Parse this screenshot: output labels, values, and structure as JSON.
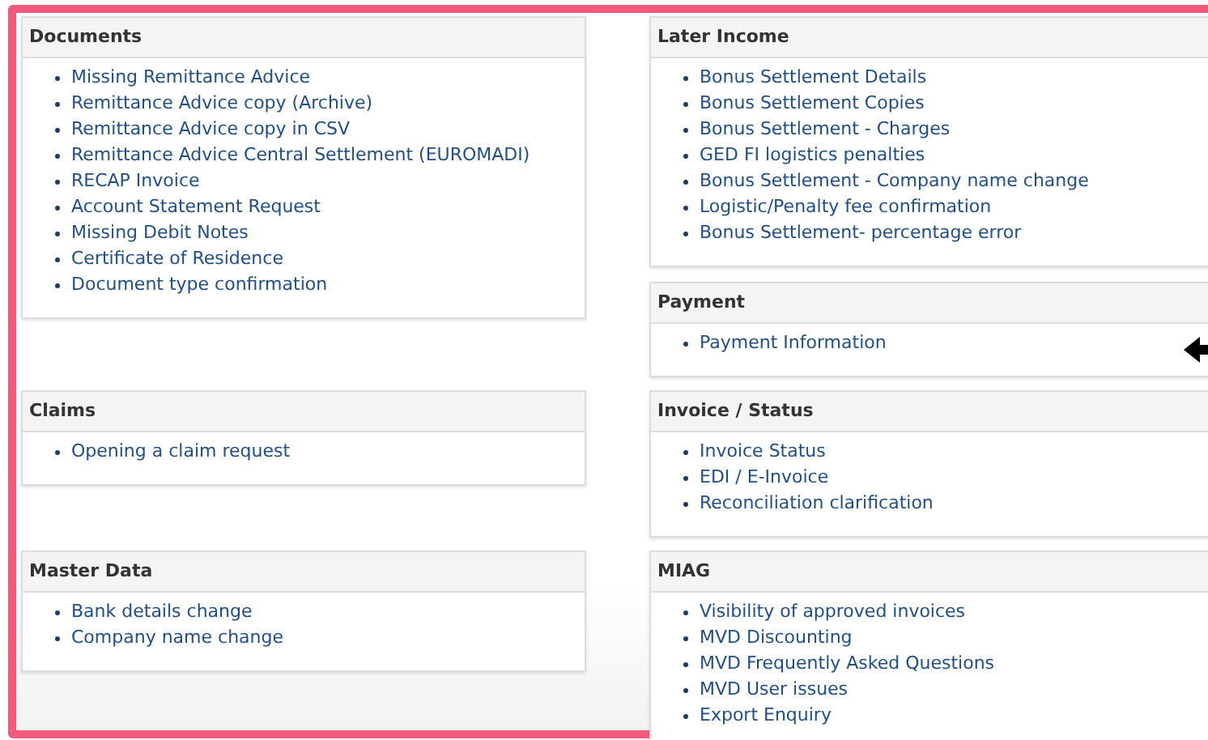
{
  "rows": [
    {
      "left": [
        {
          "title": "Documents",
          "items": [
            "Missing Remittance Advice",
            "Remittance Advice copy (Archive)",
            "Remittance Advice copy in CSV",
            "Remittance Advice Central Settlement (EUROMADI)",
            "RECAP Invoice",
            "Account Statement Request",
            "Missing Debit Notes",
            "Certificate of Residence",
            "Document type confirmation"
          ]
        }
      ],
      "right": [
        {
          "title": "Later Income",
          "items": [
            "Bonus Settlement Details",
            "Bonus Settlement Copies",
            "Bonus Settlement - Charges",
            "GED FI logistics penalties",
            "Bonus Settlement - Company name change",
            "Logistic/Penalty fee confirmation",
            "Bonus Settlement- percentage error"
          ]
        },
        {
          "title": "Payment",
          "items": [
            "Payment Information"
          ]
        }
      ]
    },
    {
      "left": [
        {
          "title": "Claims",
          "items": [
            "Opening a claim request"
          ]
        }
      ],
      "right": [
        {
          "title": "Invoice / Status",
          "items": [
            "Invoice Status",
            "EDI / E-Invoice",
            "Reconciliation clarification"
          ]
        }
      ]
    },
    {
      "left": [
        {
          "title": "Master Data",
          "items": [
            "Bank details change",
            "Company name change"
          ]
        }
      ],
      "right": [
        {
          "title": "MIAG",
          "items": [
            "Visibility of approved invoices",
            "MVD Discounting",
            "MVD Frequently Asked Questions",
            "MVD User issues",
            "Export Enquiry"
          ]
        }
      ]
    }
  ]
}
